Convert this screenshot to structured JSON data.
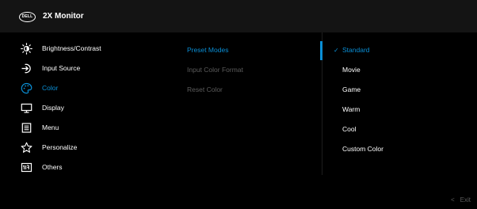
{
  "header": {
    "logo_text": "DELL",
    "title": "2X Monitor"
  },
  "menu": {
    "items": [
      {
        "label": "Brightness/Contrast",
        "icon": "brightness-icon"
      },
      {
        "label": "Input Source",
        "icon": "input-source-icon"
      },
      {
        "label": "Color",
        "icon": "color-palette-icon",
        "active": true
      },
      {
        "label": "Display",
        "icon": "display-icon"
      },
      {
        "label": "Menu",
        "icon": "menu-icon"
      },
      {
        "label": "Personalize",
        "icon": "star-icon"
      },
      {
        "label": "Others",
        "icon": "others-icon"
      }
    ]
  },
  "submenu": {
    "items": [
      {
        "label": "Preset Modes",
        "state": "selected"
      },
      {
        "label": "Input Color Format",
        "state": "disabled"
      },
      {
        "label": "Reset Color",
        "state": "disabled"
      }
    ]
  },
  "options": {
    "check_glyph": "✓",
    "items": [
      {
        "label": "Standard",
        "selected": true
      },
      {
        "label": "Movie"
      },
      {
        "label": "Game"
      },
      {
        "label": "Warm"
      },
      {
        "label": "Cool"
      },
      {
        "label": "Custom Color"
      }
    ]
  },
  "footer": {
    "exit_chevron": "<",
    "exit_label": "Exit"
  },
  "colors": {
    "accent": "#0a8fd6",
    "background": "#000000",
    "header": "#141414",
    "disabled_text": "#5c5c5c",
    "text": "#ffffff"
  }
}
